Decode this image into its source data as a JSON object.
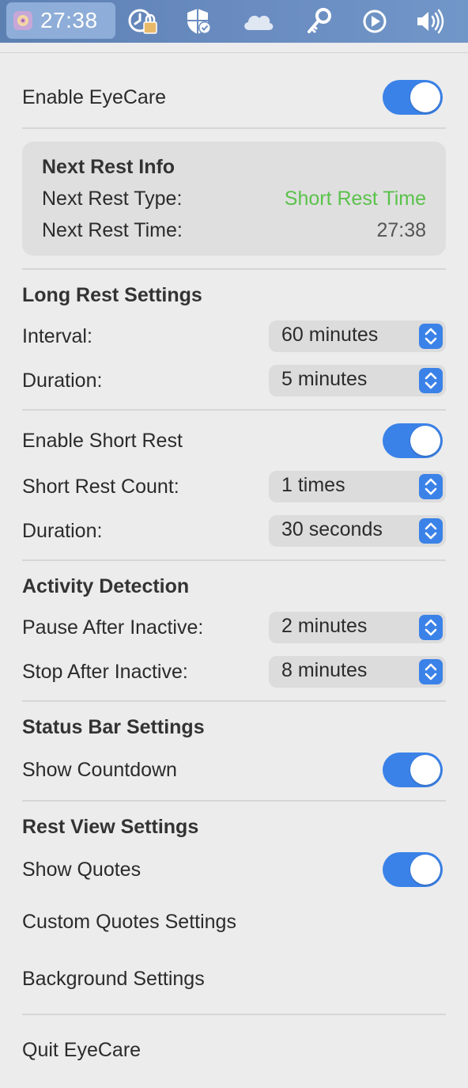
{
  "menubar": {
    "clock": "27:38",
    "icons": [
      "eyecare-app-icon",
      "clock-lock-icon",
      "shield-check-icon",
      "cloud-icon",
      "key-icon",
      "play-circle-icon",
      "speaker-icon"
    ]
  },
  "panel": {
    "enable_eyecare": {
      "label": "Enable EyeCare",
      "on": true
    },
    "next_rest_info": {
      "title": "Next Rest Info",
      "type_label": "Next Rest Type:",
      "type_value": "Short Rest Time",
      "time_label": "Next Rest Time:",
      "time_value": "27:38"
    },
    "long_rest": {
      "title": "Long Rest Settings",
      "interval_label": "Interval:",
      "interval_value": "60 minutes",
      "duration_label": "Duration:",
      "duration_value": "5 minutes"
    },
    "short_rest": {
      "enable_label": "Enable Short Rest",
      "enable_on": true,
      "count_label": "Short Rest Count:",
      "count_value": "1 times",
      "duration_label": "Duration:",
      "duration_value": "30 seconds"
    },
    "activity": {
      "title": "Activity Detection",
      "pause_label": "Pause After Inactive:",
      "pause_value": "2 minutes",
      "stop_label": "Stop After Inactive:",
      "stop_value": "8 minutes"
    },
    "status_bar": {
      "title": "Status Bar Settings",
      "countdown_label": "Show Countdown",
      "countdown_on": true
    },
    "rest_view": {
      "title": "Rest View Settings",
      "quotes_label": "Show Quotes",
      "quotes_on": true,
      "custom_quotes_label": "Custom Quotes Settings",
      "background_label": "Background Settings"
    },
    "quit_label": "Quit EyeCare"
  },
  "colors": {
    "accent": "#3b82e8",
    "green_value": "#5ac24a",
    "menubar": "#6a8cc0"
  }
}
